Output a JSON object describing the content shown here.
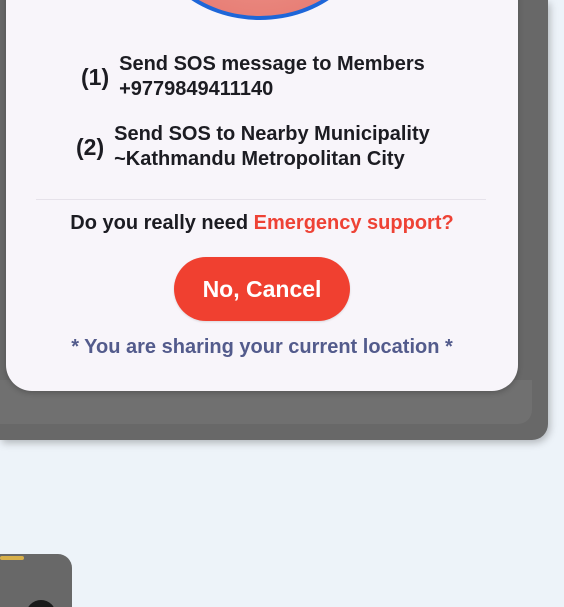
{
  "dialog": {
    "step1": {
      "number": "(1)",
      "line1": "Send SOS message to Members",
      "line2": "+9779849411140"
    },
    "step2": {
      "number": "(2)",
      "line1": "Send SOS to Nearby Municipality",
      "line2": "~Kathmandu Metropolitan City"
    },
    "question": {
      "prefix": "Do you really need ",
      "highlight": "Emergency support?"
    },
    "cancel_label": "No, Cancel",
    "location_note": "* You are sharing your current location *"
  },
  "colors": {
    "accent": "#f04030",
    "circle_border": "#1e66d8",
    "note_text": "#535b8c",
    "backdrop": "#686868"
  },
  "icons": {
    "sos_circle": "sos-circle-icon"
  }
}
